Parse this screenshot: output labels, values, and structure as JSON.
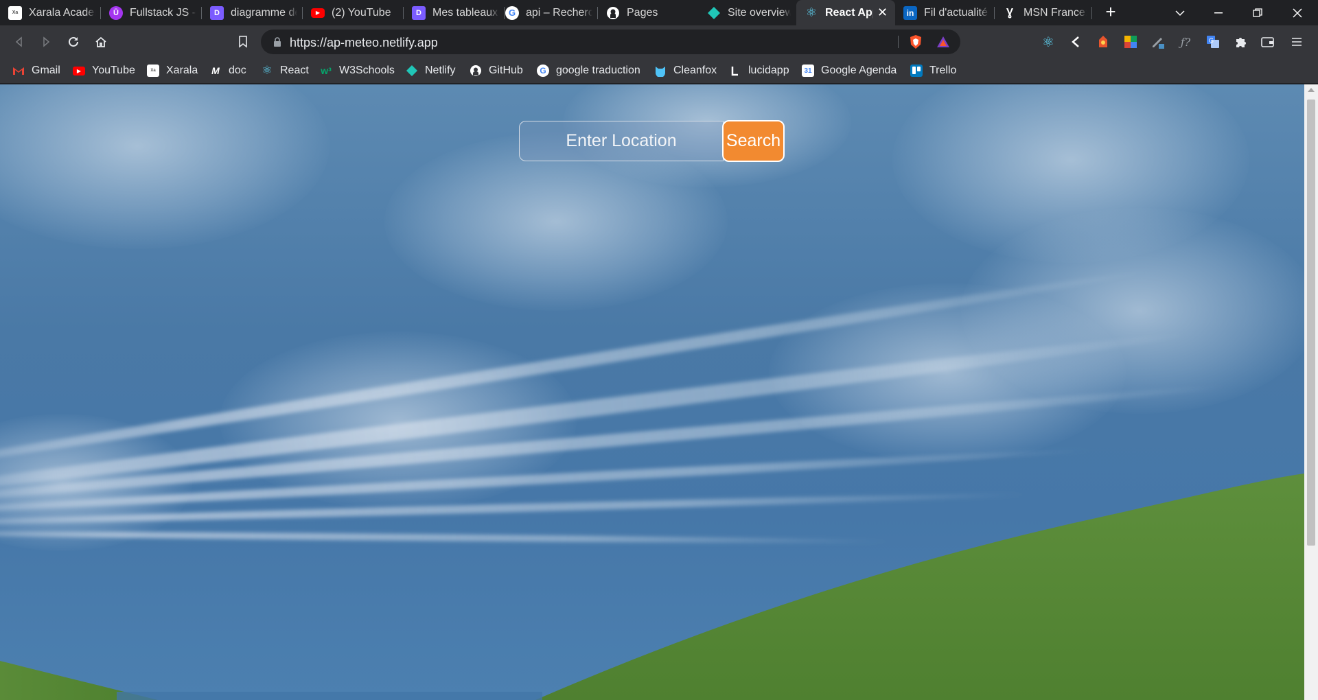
{
  "browser": {
    "tabs": [
      {
        "title": "Xarala Academ",
        "icon": "xarala-icon",
        "color": "#ffffff"
      },
      {
        "title": "Fullstack JS - R",
        "icon": "udemy-icon",
        "color": "#a435f0"
      },
      {
        "title": "diagramme de",
        "icon": "diagram-app-icon",
        "color": "#7b5cff"
      },
      {
        "title": "(2) YouTube",
        "icon": "youtube-icon",
        "color": "#ff0000"
      },
      {
        "title": "Mes tableaux c",
        "icon": "boards-app-icon",
        "color": "#7b5cff"
      },
      {
        "title": "api – Recherch",
        "icon": "google-icon",
        "color": "#ffffff"
      },
      {
        "title": "Pages",
        "icon": "github-icon",
        "color": "#ffffff"
      },
      {
        "title": "Site overview |",
        "icon": "netlify-icon",
        "color": "#20c6b7"
      },
      {
        "title": "React App",
        "icon": "react-icon",
        "color": "#61dafb",
        "active": true
      },
      {
        "title": "Fil d'actualité |",
        "icon": "linkedin-icon",
        "color": "#0a66c2"
      },
      {
        "title": "MSN France: H",
        "icon": "msn-icon",
        "color": "#ffffff"
      }
    ],
    "new_tab": "+",
    "url_host": "https://ap-meteo.netlify.app",
    "bookmarks": [
      {
        "label": "Gmail",
        "icon": "gmail-icon",
        "color": "#ea4335"
      },
      {
        "label": "YouTube",
        "icon": "youtube-icon",
        "color": "#ff0000"
      },
      {
        "label": "Xarala",
        "icon": "xarala-icon",
        "color": "#ffffff"
      },
      {
        "label": "doc",
        "icon": "doc-icon",
        "color": "#ffffff"
      },
      {
        "label": "React",
        "icon": "react-icon",
        "color": "#61dafb"
      },
      {
        "label": "W3Schools",
        "icon": "w3schools-icon",
        "color": "#04aa6d"
      },
      {
        "label": "Netlify",
        "icon": "netlify-icon",
        "color": "#20c6b7"
      },
      {
        "label": "GitHub",
        "icon": "github-icon",
        "color": "#ffffff"
      },
      {
        "label": "google traduction",
        "icon": "google-icon",
        "color": "#ffffff"
      },
      {
        "label": "Cleanfox",
        "icon": "cleanfox-icon",
        "color": "#4fc3f7"
      },
      {
        "label": "lucidapp",
        "icon": "lucid-icon",
        "color": "#ffffff"
      },
      {
        "label": "Google Agenda",
        "icon": "calendar-icon",
        "color": "#4285f4"
      },
      {
        "label": "Trello",
        "icon": "trello-icon",
        "color": "#0079bf"
      }
    ]
  },
  "page": {
    "search_placeholder": "Enter Location",
    "search_button": "Search",
    "accent": "#f28a30"
  }
}
